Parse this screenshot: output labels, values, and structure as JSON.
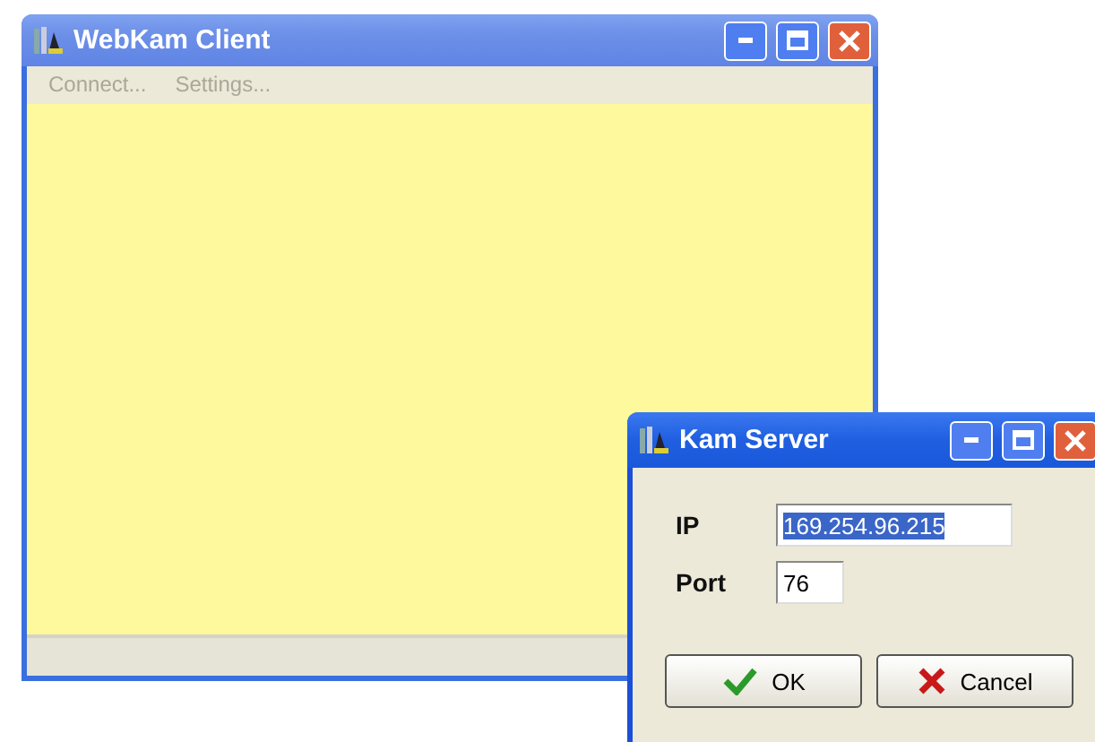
{
  "main_window": {
    "title": "WebKam Client",
    "menu": [
      {
        "label": "Connect...",
        "disabled": true
      },
      {
        "label": "Settings...",
        "disabled": true
      }
    ]
  },
  "dialog": {
    "title": "Kam Server",
    "fields": [
      {
        "label": "IP",
        "value": "169.254.96.215",
        "selected": true
      },
      {
        "label": "Port",
        "value": "76",
        "selected": false
      }
    ],
    "buttons": [
      {
        "label": "OK",
        "kind": "ok"
      },
      {
        "label": "Cancel",
        "kind": "cancel"
      }
    ]
  }
}
